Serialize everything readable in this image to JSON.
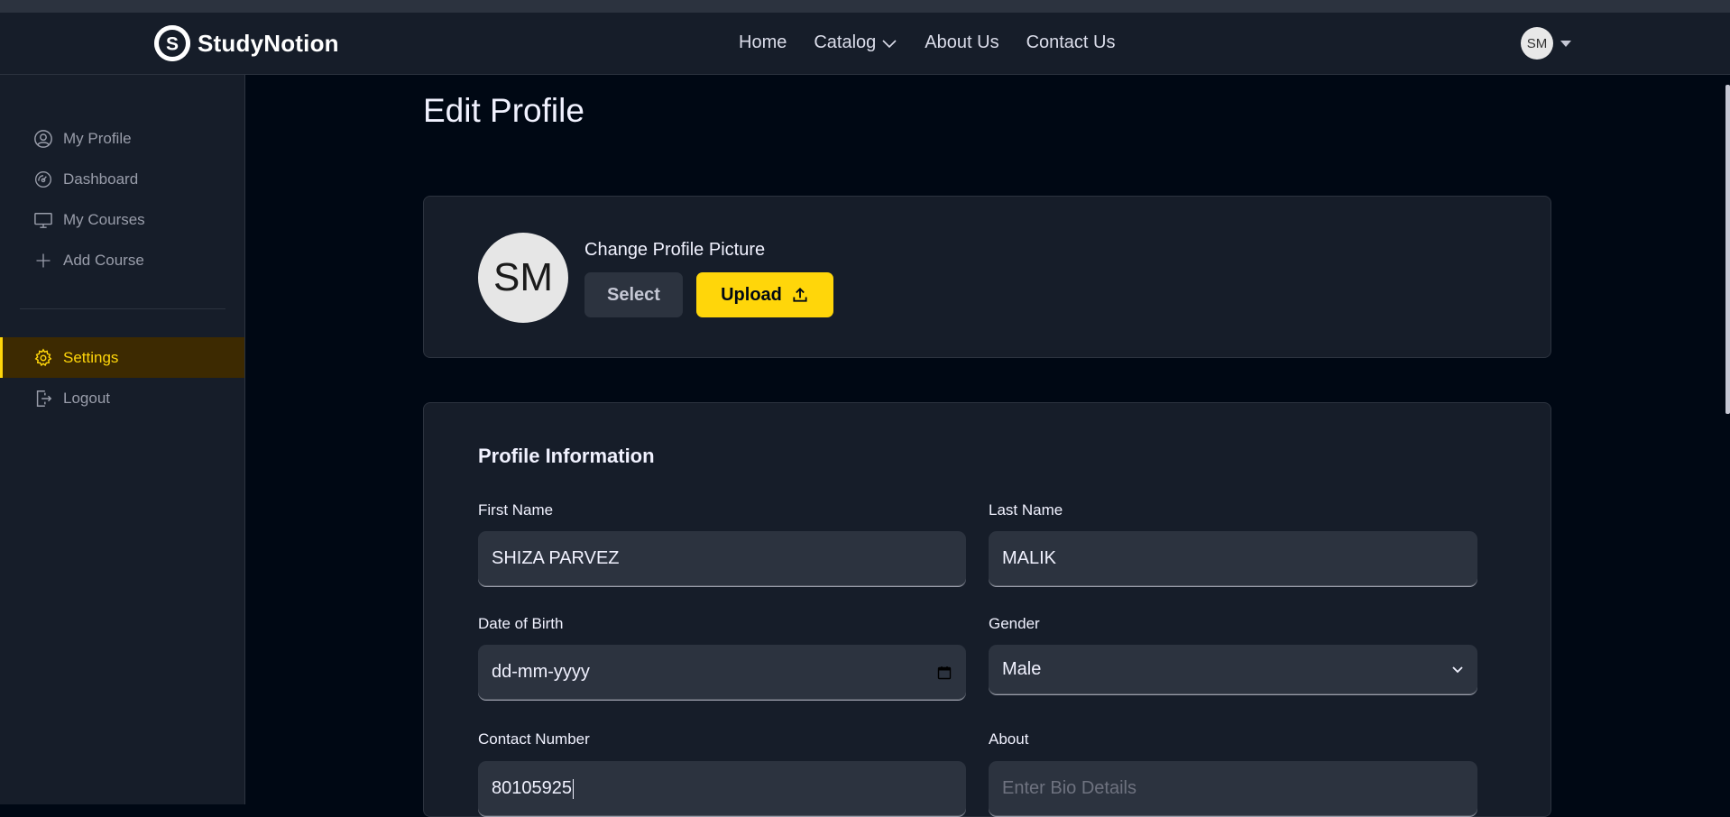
{
  "app": {
    "name": "StudyNotion",
    "logo_letter": "S"
  },
  "nav": {
    "links": [
      {
        "label": "Home"
      },
      {
        "label": "Catalog"
      },
      {
        "label": "About Us"
      },
      {
        "label": "Contact Us"
      }
    ],
    "avatar_initials": "SM"
  },
  "sidebar": {
    "items": [
      {
        "label": "My Profile",
        "icon": "user-circle-icon"
      },
      {
        "label": "Dashboard",
        "icon": "gauge-icon"
      },
      {
        "label": "My Courses",
        "icon": "monitor-icon"
      },
      {
        "label": "Add Course",
        "icon": "plus-icon"
      }
    ],
    "bottom_items": [
      {
        "label": "Settings",
        "icon": "gear-icon",
        "active": true
      },
      {
        "label": "Logout",
        "icon": "logout-icon"
      }
    ]
  },
  "page": {
    "title": "Edit Profile"
  },
  "profile_picture": {
    "initials": "SM",
    "label": "Change Profile Picture",
    "select_label": "Select",
    "upload_label": "Upload"
  },
  "profile_info": {
    "title": "Profile Information",
    "first_name": {
      "label": "First Name",
      "value": "SHIZA PARVEZ"
    },
    "last_name": {
      "label": "Last Name",
      "value": "MALIK"
    },
    "dob": {
      "label": "Date of Birth",
      "placeholder": "dd-mm-yyyy"
    },
    "gender": {
      "label": "Gender",
      "value": "Male"
    },
    "contact": {
      "label": "Contact Number",
      "value": "80105925"
    },
    "about": {
      "label": "About",
      "placeholder": "Enter Bio Details"
    }
  },
  "colors": {
    "accent": "#FFD60A",
    "background": "#000814",
    "surface": "#161D29",
    "input": "#2C333F",
    "active_bg": "#3D2A01"
  }
}
